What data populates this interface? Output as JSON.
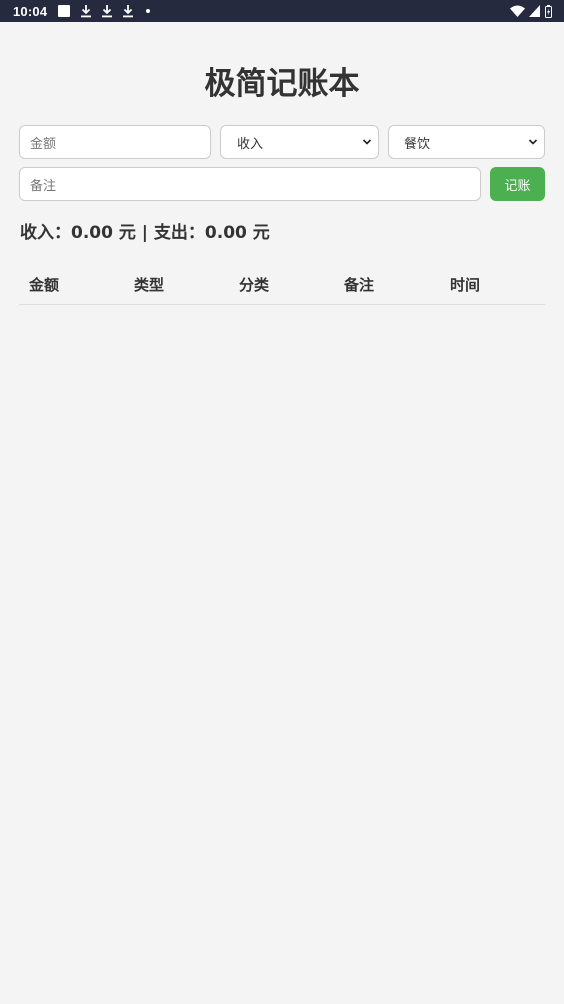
{
  "status_bar": {
    "time": "10:04",
    "notification_icons": [
      "square-icon",
      "download-icon",
      "download-icon",
      "download-icon",
      "dot-icon"
    ],
    "system_icons": [
      "wifi-icon",
      "signal-icon",
      "battery-icon"
    ]
  },
  "app": {
    "title": "极简记账本"
  },
  "form": {
    "amount_placeholder": "金额",
    "type_selected": "收入",
    "category_selected": "餐饮",
    "note_placeholder": "备注",
    "submit_label": "记账",
    "submit_color": "#4caf50"
  },
  "summary": {
    "text": "收入：0.00 元 | 支出：0.00 元"
  },
  "table": {
    "headers": [
      "金额",
      "类型",
      "分类",
      "备注",
      "时间"
    ],
    "rows": []
  }
}
